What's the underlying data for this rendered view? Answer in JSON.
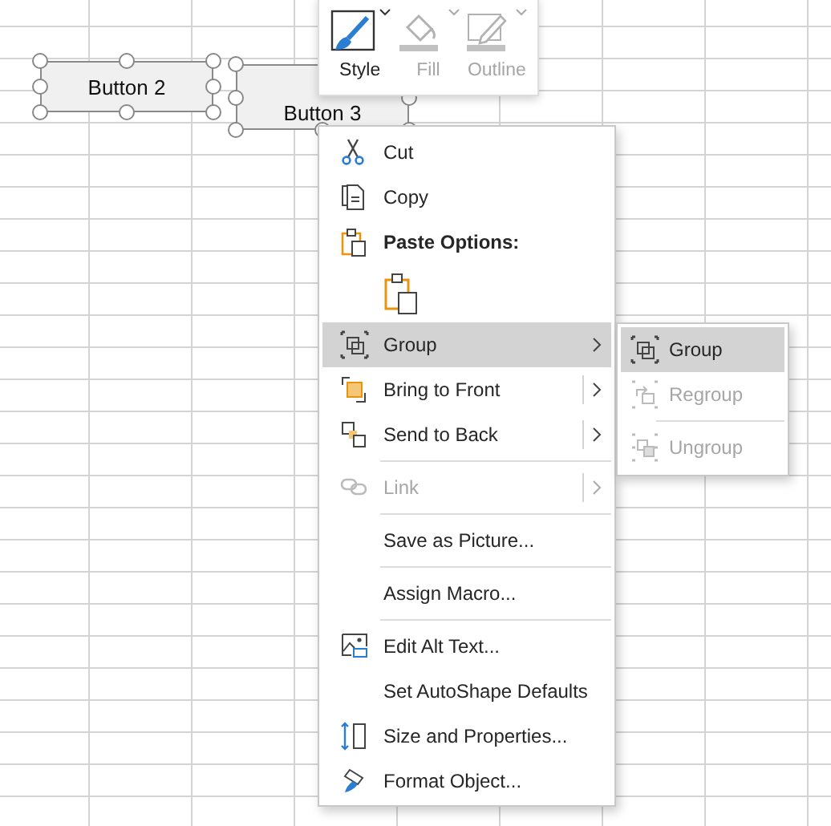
{
  "shapes": [
    {
      "label": "Button 2",
      "selected": true
    },
    {
      "label": "Button 3",
      "selected": true
    }
  ],
  "mini_toolbar": [
    {
      "label": "Style",
      "disabled": false
    },
    {
      "label": "Fill",
      "disabled": true
    },
    {
      "label": "Outline",
      "disabled": true
    }
  ],
  "context_menu": [
    {
      "kind": "item",
      "label": "Cut",
      "disabled": false,
      "selected": false
    },
    {
      "kind": "item",
      "label": "Copy",
      "disabled": false,
      "selected": false
    },
    {
      "kind": "header",
      "label": "Paste Options:"
    },
    {
      "kind": "paste-option"
    },
    {
      "kind": "item",
      "label": "Group",
      "disabled": false,
      "selected": true,
      "submenu": true,
      "split": false
    },
    {
      "kind": "item",
      "label": "Bring to Front",
      "disabled": false,
      "selected": false,
      "submenu": true,
      "split": true
    },
    {
      "kind": "item",
      "label": "Send to Back",
      "disabled": false,
      "selected": false,
      "submenu": true,
      "split": true
    },
    {
      "kind": "separator"
    },
    {
      "kind": "item",
      "label": "Link",
      "disabled": true,
      "selected": false,
      "submenu": true,
      "split": true
    },
    {
      "kind": "separator"
    },
    {
      "kind": "item",
      "label": "Save as Picture...",
      "disabled": false,
      "selected": false
    },
    {
      "kind": "separator"
    },
    {
      "kind": "item",
      "label": "Assign Macro...",
      "disabled": false,
      "selected": false
    },
    {
      "kind": "separator"
    },
    {
      "kind": "item",
      "label": "Edit Alt Text...",
      "disabled": false,
      "selected": false
    },
    {
      "kind": "item",
      "label": "Set AutoShape Defaults",
      "disabled": false,
      "selected": false
    },
    {
      "kind": "item",
      "label": "Size and Properties...",
      "disabled": false,
      "selected": false
    },
    {
      "kind": "item",
      "label": "Format Object...",
      "disabled": false,
      "selected": false
    }
  ],
  "submenu": [
    {
      "kind": "item",
      "label": "Group",
      "disabled": false,
      "selected": true
    },
    {
      "kind": "item",
      "label": "Regroup",
      "disabled": true,
      "selected": false
    },
    {
      "kind": "separator"
    },
    {
      "kind": "item",
      "label": "Ungroup",
      "disabled": true,
      "selected": false
    }
  ]
}
